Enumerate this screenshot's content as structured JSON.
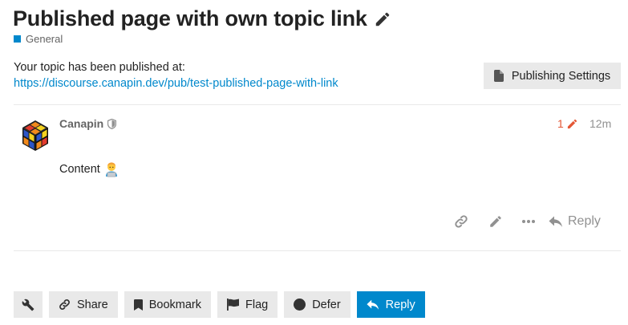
{
  "topic": {
    "title": "Published page with own topic link",
    "category": "General",
    "category_color": "#0088cc"
  },
  "published": {
    "message": "Your topic has been published at:",
    "url": "https://discourse.canapin.dev/pub/test-published-page-with-link",
    "settings_label": "Publishing Settings"
  },
  "post": {
    "username": "Canapin",
    "edit_count": "1",
    "time": "12m",
    "content": "Content",
    "content_emoji": "technologist",
    "reply_label": "Reply"
  },
  "footer": {
    "share_label": "Share",
    "bookmark_label": "Bookmark",
    "flag_label": "Flag",
    "defer_label": "Defer",
    "reply_label": "Reply"
  },
  "colors": {
    "accent": "#0088cc",
    "edit_indicator": "#e45735",
    "muted": "#919191",
    "button_bg": "#e9e9e9"
  }
}
